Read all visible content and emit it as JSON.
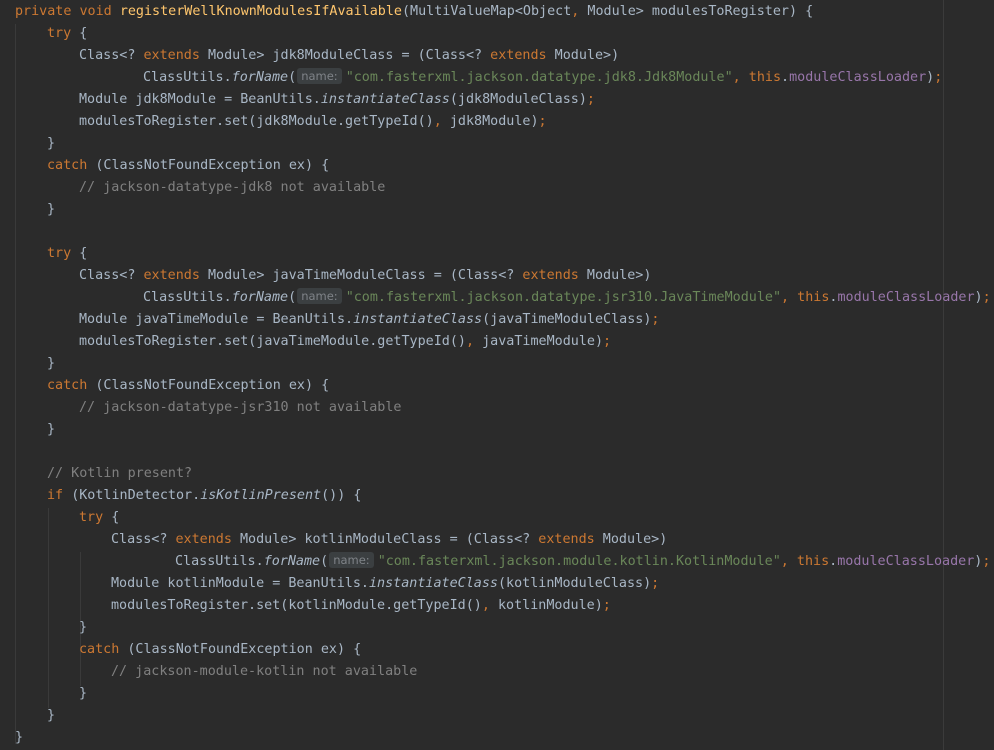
{
  "editor": {
    "lines": [
      {
        "indent": 0,
        "tokens": [
          [
            "kw",
            "private void "
          ],
          [
            "fn",
            "registerWellKnownModulesIfAvailable"
          ],
          [
            "p",
            "(MultiValueMap<Object"
          ],
          [
            "kw",
            ", "
          ],
          [
            "p",
            "Module> modulesToRegister) {"
          ]
        ]
      },
      {
        "indent": 1,
        "tokens": [
          [
            "kw",
            "try "
          ],
          [
            "p",
            "{"
          ]
        ]
      },
      {
        "indent": 2,
        "tokens": [
          [
            "p",
            "Class<? "
          ],
          [
            "kw",
            "extends "
          ],
          [
            "p",
            "Module> jdk8ModuleClass = (Class<? "
          ],
          [
            "kw",
            "extends "
          ],
          [
            "p",
            "Module>)"
          ]
        ]
      },
      {
        "indent": 4,
        "tokens": [
          [
            "p",
            "ClassUtils."
          ],
          [
            "it",
            "forName"
          ],
          [
            "p",
            "("
          ],
          [
            "hint",
            "name:"
          ],
          [
            "str",
            "\"com.fasterxml.jackson.datatype.jdk8.Jdk8Module\""
          ],
          [
            "kw",
            ", this"
          ],
          [
            "p",
            "."
          ],
          [
            "fld",
            "moduleClassLoader"
          ],
          [
            "p",
            ")"
          ],
          [
            "kw",
            ";"
          ]
        ]
      },
      {
        "indent": 2,
        "tokens": [
          [
            "p",
            "Module jdk8Module = BeanUtils."
          ],
          [
            "it",
            "instantiateClass"
          ],
          [
            "p",
            "(jdk8ModuleClass)"
          ],
          [
            "kw",
            ";"
          ]
        ]
      },
      {
        "indent": 2,
        "tokens": [
          [
            "p",
            "modulesToRegister.set(jdk8Module.getTypeId()"
          ],
          [
            "kw",
            ", "
          ],
          [
            "p",
            "jdk8Module)"
          ],
          [
            "kw",
            ";"
          ]
        ]
      },
      {
        "indent": 1,
        "tokens": [
          [
            "p",
            "}"
          ]
        ]
      },
      {
        "indent": 1,
        "tokens": [
          [
            "kw",
            "catch "
          ],
          [
            "p",
            "(ClassNotFoundException ex) {"
          ]
        ]
      },
      {
        "indent": 2,
        "tokens": [
          [
            "cmt",
            "// jackson-datatype-jdk8 not available"
          ]
        ]
      },
      {
        "indent": 1,
        "tokens": [
          [
            "p",
            "}"
          ]
        ]
      },
      {
        "indent": 0,
        "tokens": []
      },
      {
        "indent": 1,
        "tokens": [
          [
            "kw",
            "try "
          ],
          [
            "p",
            "{"
          ]
        ]
      },
      {
        "indent": 2,
        "tokens": [
          [
            "p",
            "Class<? "
          ],
          [
            "kw",
            "extends "
          ],
          [
            "p",
            "Module> javaTimeModuleClass = (Class<? "
          ],
          [
            "kw",
            "extends "
          ],
          [
            "p",
            "Module>)"
          ]
        ]
      },
      {
        "indent": 4,
        "tokens": [
          [
            "p",
            "ClassUtils."
          ],
          [
            "it",
            "forName"
          ],
          [
            "p",
            "("
          ],
          [
            "hint",
            "name:"
          ],
          [
            "str",
            "\"com.fasterxml.jackson.datatype.jsr310.JavaTimeModule\""
          ],
          [
            "kw",
            ", this"
          ],
          [
            "p",
            "."
          ],
          [
            "fld",
            "moduleClassLoader"
          ],
          [
            "p",
            ")"
          ],
          [
            "kw",
            ";"
          ]
        ]
      },
      {
        "indent": 2,
        "tokens": [
          [
            "p",
            "Module javaTimeModule = BeanUtils."
          ],
          [
            "it",
            "instantiateClass"
          ],
          [
            "p",
            "(javaTimeModuleClass)"
          ],
          [
            "kw",
            ";"
          ]
        ]
      },
      {
        "indent": 2,
        "tokens": [
          [
            "p",
            "modulesToRegister.set(javaTimeModule.getTypeId()"
          ],
          [
            "kw",
            ", "
          ],
          [
            "p",
            "javaTimeModule)"
          ],
          [
            "kw",
            ";"
          ]
        ]
      },
      {
        "indent": 1,
        "tokens": [
          [
            "p",
            "}"
          ]
        ]
      },
      {
        "indent": 1,
        "tokens": [
          [
            "kw",
            "catch "
          ],
          [
            "p",
            "(ClassNotFoundException ex) {"
          ]
        ]
      },
      {
        "indent": 2,
        "tokens": [
          [
            "cmt",
            "// jackson-datatype-jsr310 not available"
          ]
        ]
      },
      {
        "indent": 1,
        "tokens": [
          [
            "p",
            "}"
          ]
        ]
      },
      {
        "indent": 0,
        "tokens": []
      },
      {
        "indent": 1,
        "tokens": [
          [
            "cmt",
            "// Kotlin present?"
          ]
        ]
      },
      {
        "indent": 1,
        "tokens": [
          [
            "kw",
            "if "
          ],
          [
            "p",
            "(KotlinDetector."
          ],
          [
            "it",
            "isKotlinPresent"
          ],
          [
            "p",
            "()) {"
          ]
        ]
      },
      {
        "indent": 2,
        "tokens": [
          [
            "kw",
            "try "
          ],
          [
            "p",
            "{"
          ]
        ]
      },
      {
        "indent": 3,
        "tokens": [
          [
            "p",
            "Class<? "
          ],
          [
            "kw",
            "extends "
          ],
          [
            "p",
            "Module> kotlinModuleClass = (Class<? "
          ],
          [
            "kw",
            "extends "
          ],
          [
            "p",
            "Module>)"
          ]
        ]
      },
      {
        "indent": 5,
        "tokens": [
          [
            "p",
            "ClassUtils."
          ],
          [
            "it",
            "forName"
          ],
          [
            "p",
            "("
          ],
          [
            "hint",
            "name:"
          ],
          [
            "str",
            "\"com.fasterxml.jackson.module.kotlin.KotlinModule\""
          ],
          [
            "kw",
            ", this"
          ],
          [
            "p",
            "."
          ],
          [
            "fld",
            "moduleClassLoader"
          ],
          [
            "p",
            ")"
          ],
          [
            "kw",
            ";"
          ]
        ]
      },
      {
        "indent": 3,
        "tokens": [
          [
            "p",
            "Module kotlinModule = BeanUtils."
          ],
          [
            "it",
            "instantiateClass"
          ],
          [
            "p",
            "(kotlinModuleClass)"
          ],
          [
            "kw",
            ";"
          ]
        ]
      },
      {
        "indent": 3,
        "tokens": [
          [
            "p",
            "modulesToRegister.set(kotlinModule.getTypeId()"
          ],
          [
            "kw",
            ", "
          ],
          [
            "p",
            "kotlinModule)"
          ],
          [
            "kw",
            ";"
          ]
        ]
      },
      {
        "indent": 2,
        "tokens": [
          [
            "p",
            "}"
          ]
        ]
      },
      {
        "indent": 2,
        "tokens": [
          [
            "kw",
            "catch "
          ],
          [
            "p",
            "(ClassNotFoundException ex) {"
          ]
        ]
      },
      {
        "indent": 3,
        "tokens": [
          [
            "cmt",
            "// jackson-module-kotlin not available"
          ]
        ]
      },
      {
        "indent": 2,
        "tokens": [
          [
            "p",
            "}"
          ]
        ]
      },
      {
        "indent": 1,
        "tokens": [
          [
            "p",
            "}"
          ]
        ]
      },
      {
        "indent": 0,
        "tokens": [
          [
            "p",
            "}"
          ]
        ]
      }
    ]
  }
}
